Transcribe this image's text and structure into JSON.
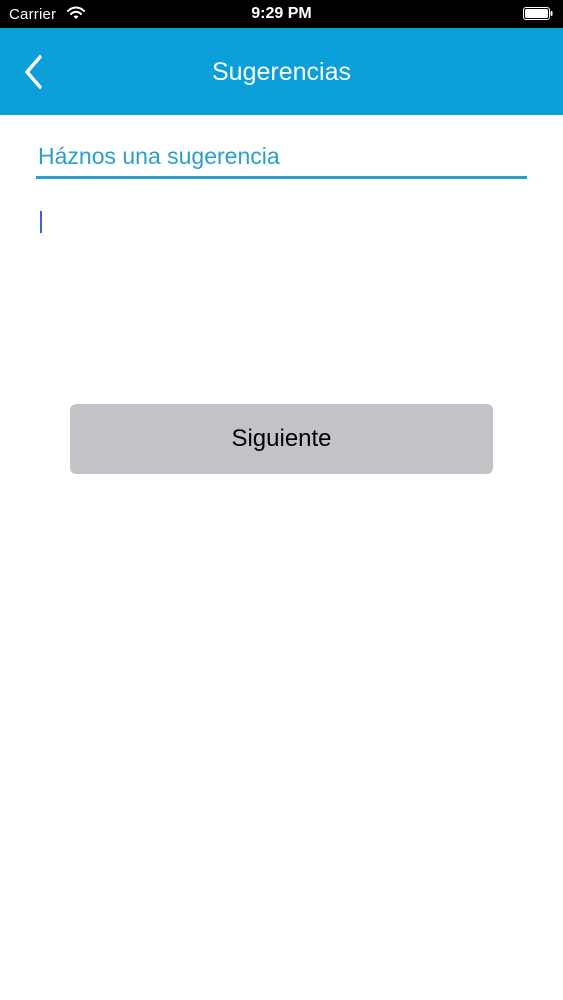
{
  "status_bar": {
    "carrier": "Carrier",
    "time": "9:29 PM",
    "wifi_icon": "wifi-icon",
    "battery_icon": "battery-icon"
  },
  "nav": {
    "back_icon": "chevron-left-icon",
    "title": "Sugerencias"
  },
  "form": {
    "label": "Háznos una sugerencia",
    "text_value": "",
    "next_label": "Siguiente"
  },
  "colors": {
    "nav_background": "#0a9fd8",
    "accent": "#2a9fc9",
    "button_background": "#c3c2c7",
    "caret": "#3b63d8"
  }
}
